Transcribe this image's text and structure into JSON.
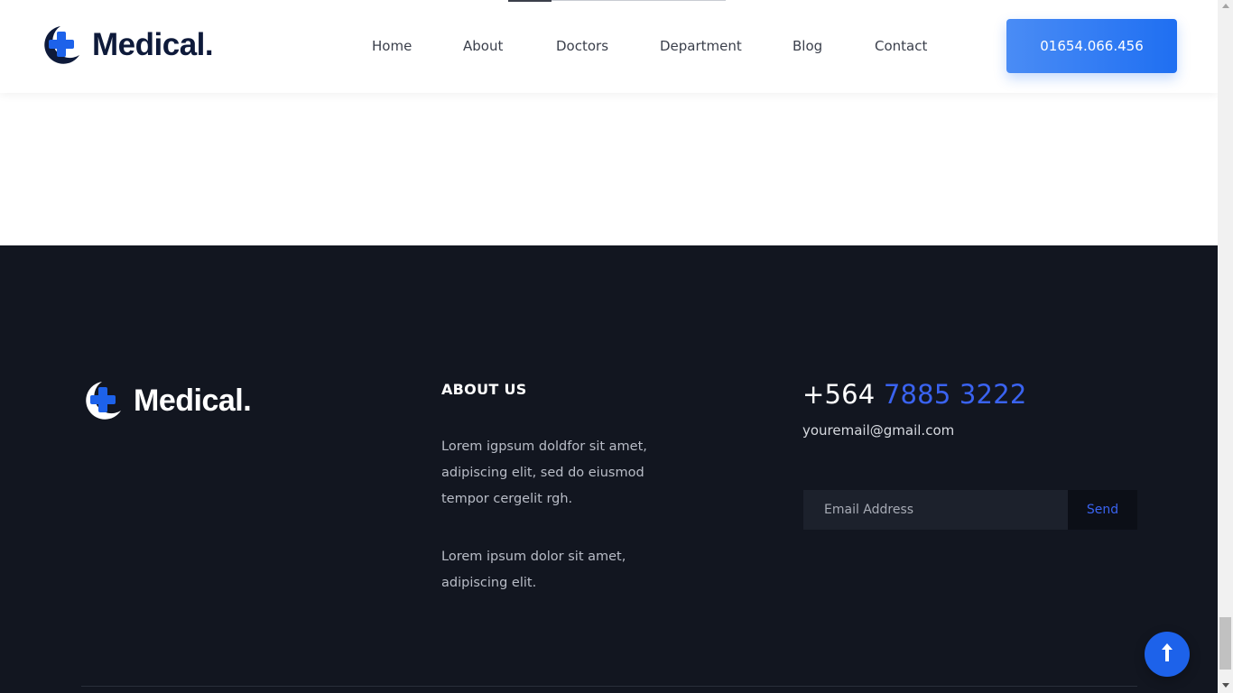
{
  "brand": {
    "name": "Medical."
  },
  "nav": {
    "items": [
      {
        "label": "Home"
      },
      {
        "label": "About"
      },
      {
        "label": "Doctors"
      },
      {
        "label": "Department"
      },
      {
        "label": "Blog"
      },
      {
        "label": "Contact"
      }
    ],
    "phone_button": "01654.066.456"
  },
  "footer": {
    "brand": "Medical.",
    "about": {
      "title": "ABOUT US",
      "paragraph1": "Lorem igpsum doldfor sit amet, adipiscing elit, sed do eiusmod tempor cergelit rgh.",
      "paragraph2": "Lorem ipsum dolor sit amet, adipiscing elit."
    },
    "contact": {
      "phone_prefix": "+564 ",
      "phone_number": "7885 3222",
      "email": "youremail@gmail.com"
    },
    "newsletter": {
      "placeholder": "Email Address",
      "button": "Send"
    }
  },
  "icons": {
    "logo": "medical-cross-logo-icon",
    "back_to_top": "arrow-up-icon"
  },
  "colors": {
    "primary": "#1f6ff2",
    "accent_blue": "#3a63f0",
    "footer_bg": "#121620",
    "brand_dark": "#0e1a3a"
  }
}
